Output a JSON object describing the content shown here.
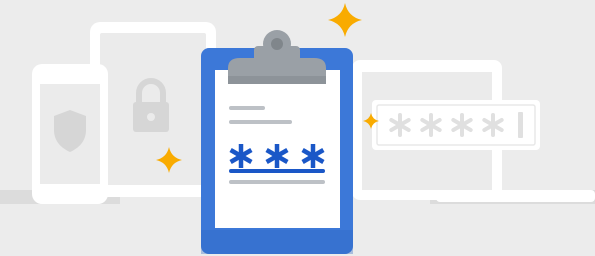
{
  "illustration": {
    "subject": "password-manager-clipboard-banner",
    "colors": {
      "background": "#ececec",
      "floor_shadow": "#dcdcdc",
      "device_outline": "#ffffff",
      "device_fill": "#ebebeb",
      "device_icon": "#d6d6d6",
      "clipboard_blue": "#3c78d8",
      "clipboard_blue_dark": "#2f66c4",
      "clip_gray": "#9aa0a6",
      "clip_gray_dark": "#80868b",
      "paper": "#ffffff",
      "paper_lines": "#bdc1c6",
      "password_asterisks": "#1a57c7",
      "sparkle": "#f9ab00",
      "field_asterisks": "#e6e6e6"
    },
    "icons": [
      "phone-icon",
      "shield-icon",
      "tablet-icon",
      "lock-icon",
      "clipboard-icon",
      "laptop-icon",
      "password-field-icon",
      "sparkle-icon"
    ]
  }
}
